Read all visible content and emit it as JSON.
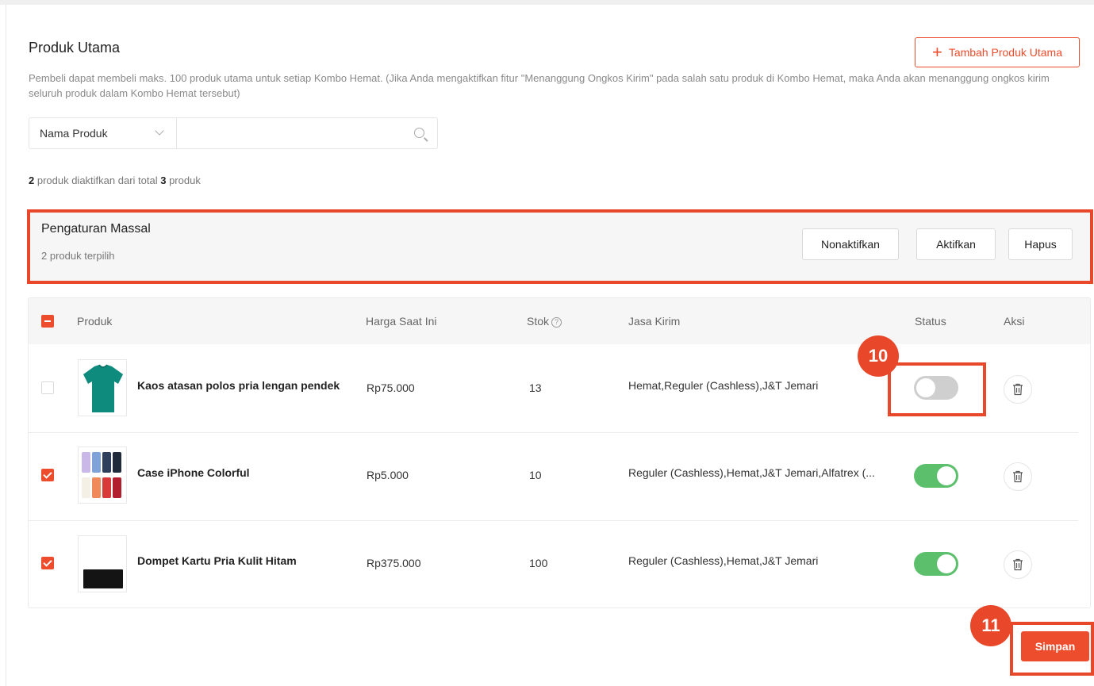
{
  "header": {
    "title": "Produk Utama",
    "description": "Pembeli dapat membeli maks. 100 produk utama untuk setiap Kombo Hemat. (Jika Anda mengaktifkan fitur \"Menanggung Ongkos Kirim\" pada salah satu produk di Kombo Hemat, maka Anda akan menanggung ongkos kirim seluruh produk dalam Kombo Hemat tersebut)",
    "add_button": "Tambah Produk Utama"
  },
  "search": {
    "field_select": "Nama Produk",
    "placeholder": ""
  },
  "summary": {
    "active_count": "2",
    "text_middle": " produk diaktifkan dari total ",
    "total_count": "3",
    "text_end": " produk"
  },
  "bulk": {
    "title": "Pengaturan Massal",
    "selected_text": "2 produk terpilih",
    "deactivate": "Nonaktifkan",
    "activate": "Aktifkan",
    "delete": "Hapus"
  },
  "table": {
    "columns": {
      "product": "Produk",
      "price": "Harga Saat Ini",
      "stock": "Stok",
      "stock_help": "?",
      "shipping": "Jasa Kirim",
      "status": "Status",
      "action": "Aksi"
    },
    "rows": [
      {
        "name": "Kaos atasan polos pria lengan pendek",
        "price": "Rp75.000",
        "stock": "13",
        "shipping": "Hemat,Reguler (Cashless),J&T Jemari",
        "status": "off",
        "selected": false
      },
      {
        "name": "Case iPhone Colorful",
        "price": "Rp5.000",
        "stock": "10",
        "shipping": "Reguler (Cashless),Hemat,J&T Jemari,Alfatrex (...",
        "status": "on",
        "selected": true
      },
      {
        "name": "Dompet Kartu Pria Kulit Hitam",
        "price": "Rp375.000",
        "stock": "100",
        "shipping": "Reguler (Cashless),Hemat,J&T Jemari",
        "status": "on",
        "selected": true
      }
    ]
  },
  "callouts": {
    "first": "10",
    "second": "11"
  },
  "footer": {
    "save": "Simpan"
  },
  "colors": {
    "accent": "#ee4d2d",
    "callout": "#e8472a",
    "toggle_on": "#5bbf6b",
    "toggle_off": "#cfcfcf"
  }
}
